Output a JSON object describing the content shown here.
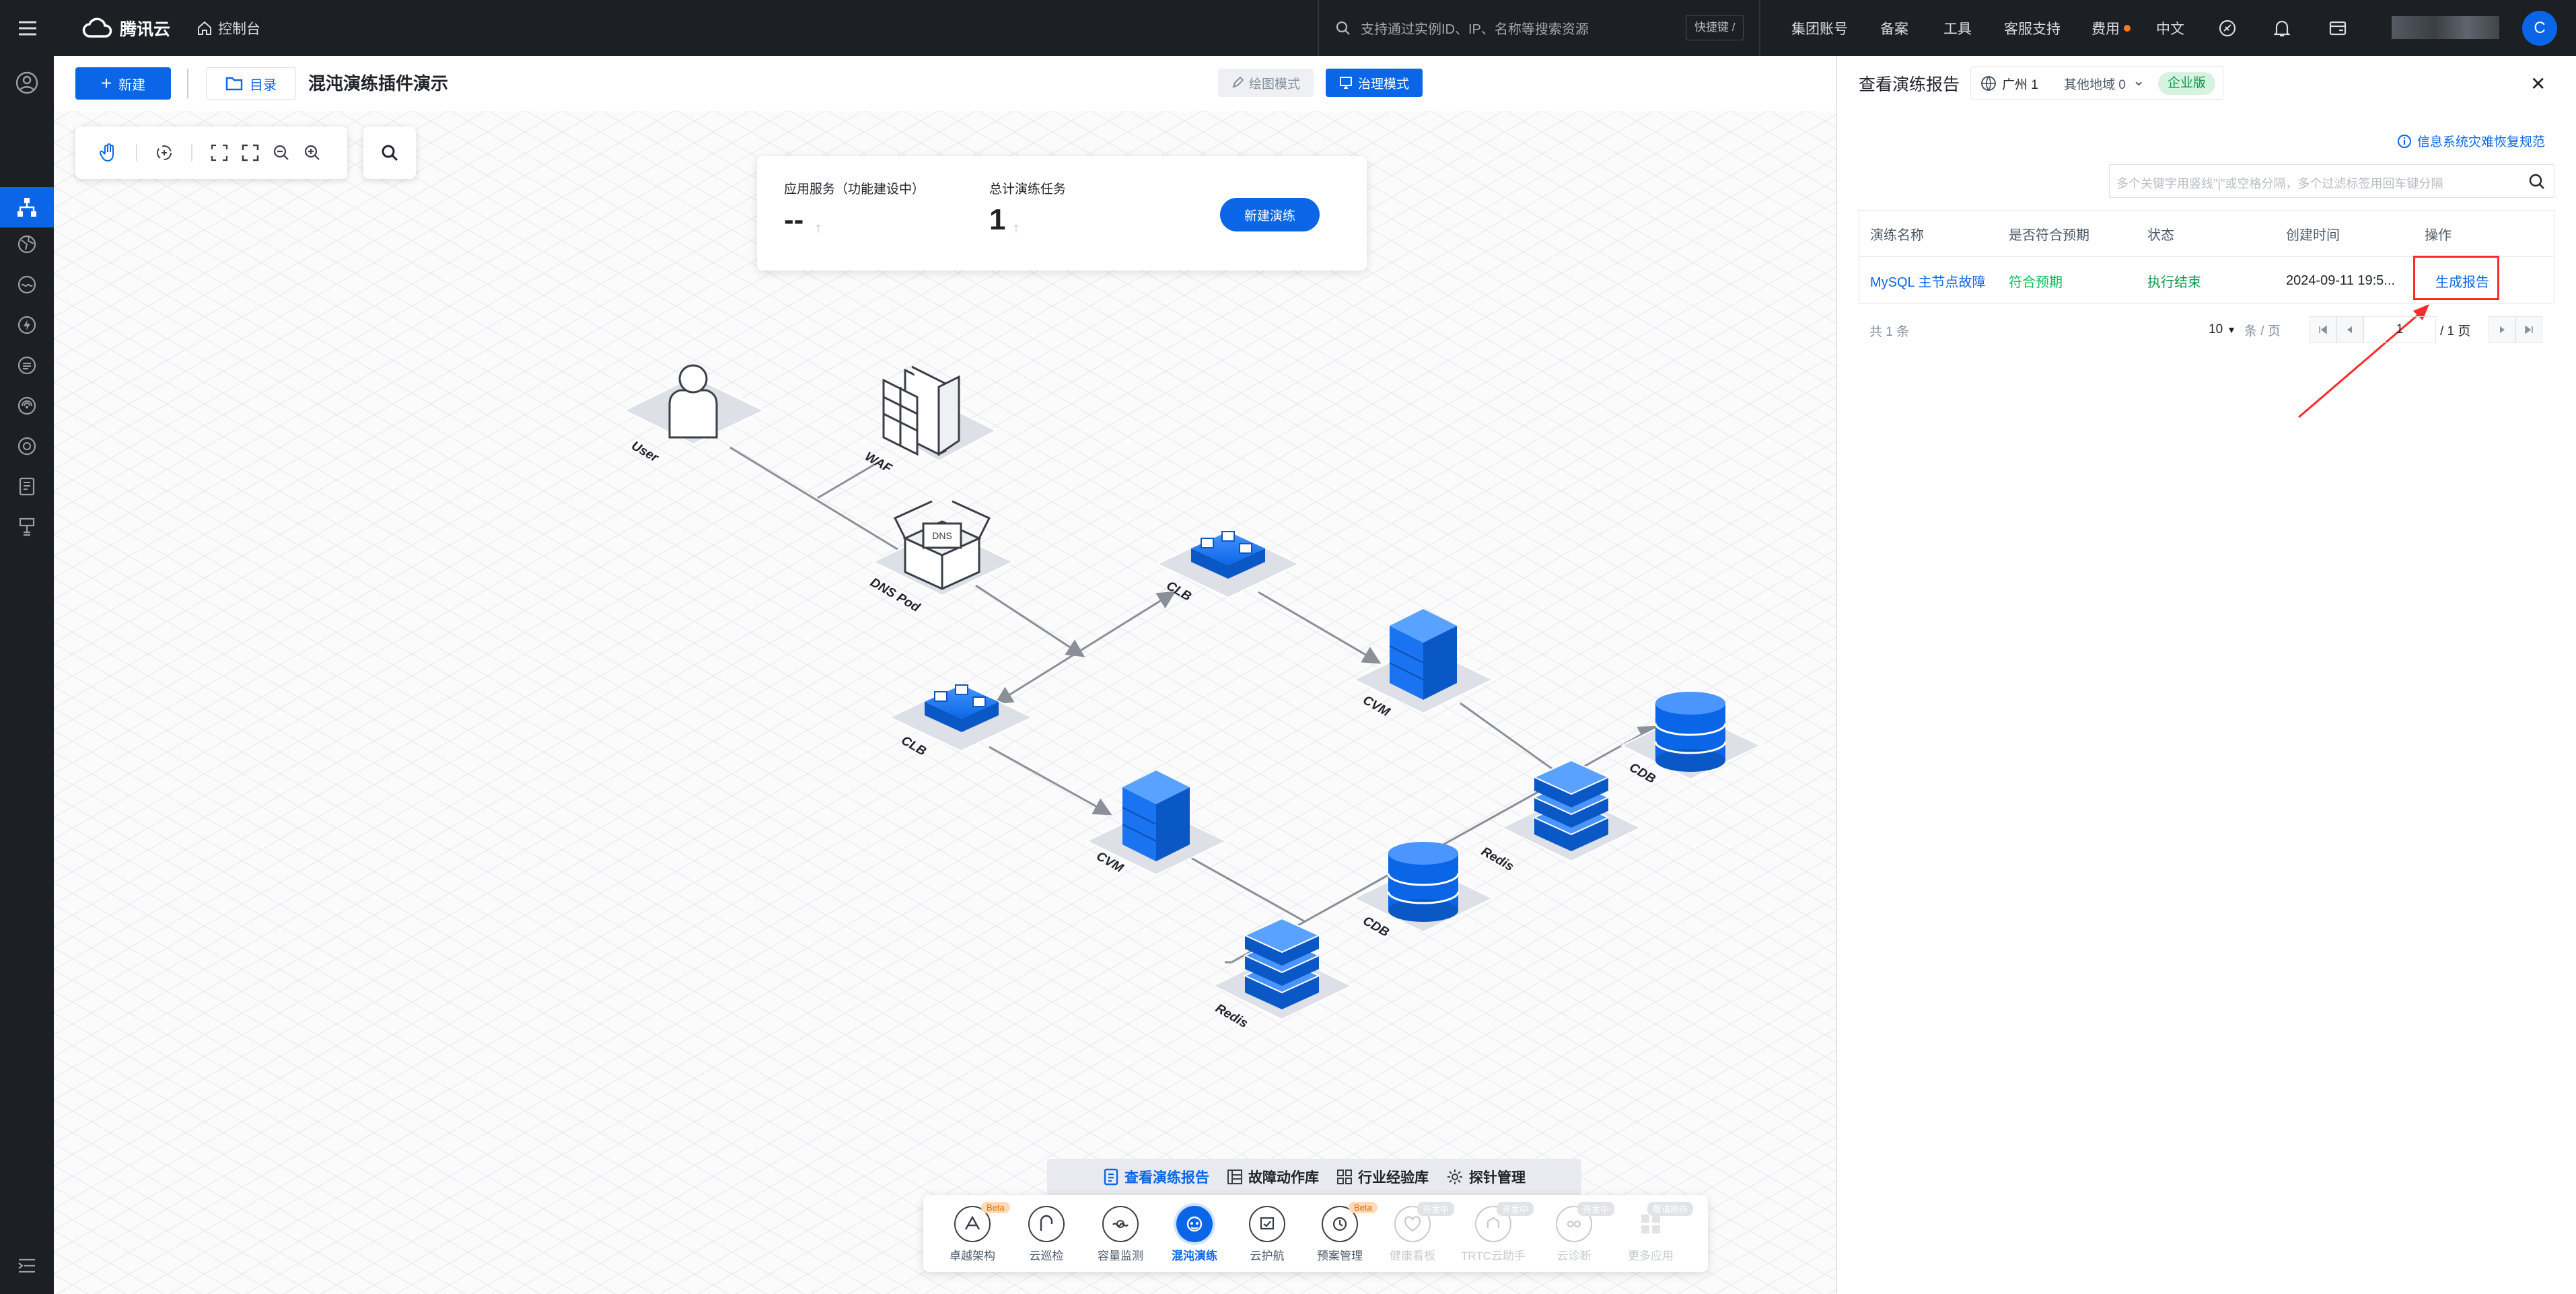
{
  "topbar": {
    "brand": "腾讯云",
    "console": "控制台",
    "search_placeholder": "支持通过实例ID、IP、名称等搜索资源",
    "shortcut": "快捷键 /",
    "nav": [
      "集团账号",
      "备案",
      "工具",
      "客服支持",
      "费用",
      "中文"
    ],
    "avatar": "C"
  },
  "editor": {
    "new_label": "新建",
    "catalog_label": "目录",
    "title": "混沌演练插件演示",
    "draw_mode": "绘图模式",
    "govern_mode": "治理模式"
  },
  "stats": {
    "app_service_label": "应用服务（功能建设中）",
    "app_service_value": "--",
    "total_tasks_label": "总计演练任务",
    "total_tasks_value": "1",
    "new_drill": "新建演练"
  },
  "nodes": {
    "user": "User",
    "waf": "WAF",
    "dns_pod": "DNS Pod",
    "dns_text": "DNS",
    "clb_top": "CLB",
    "clb_left": "CLB",
    "cvm_top": "CVM",
    "cvm_bottom": "CVM",
    "cdb_right": "CDB",
    "cdb_mid": "CDB",
    "redis_right": "Redis",
    "redis_bottom": "Redis"
  },
  "dock_tabs": [
    "查看演练报告",
    "故障动作库",
    "行业经验库",
    "探针管理"
  ],
  "dock_items": [
    {
      "label": "卓越架构",
      "badge": "Beta"
    },
    {
      "label": "云巡检",
      "badge": ""
    },
    {
      "label": "容量监测",
      "badge": ""
    },
    {
      "label": "混沌演练",
      "badge": ""
    },
    {
      "label": "云护航",
      "badge": ""
    },
    {
      "label": "预案管理",
      "badge": "Beta"
    },
    {
      "label": "健康看板",
      "badge": "开发中"
    },
    {
      "label": "TRTC云助手",
      "badge": "开发中"
    },
    {
      "label": "云诊断",
      "badge": "开发中"
    },
    {
      "label": "更多应用",
      "badge": "敬请期待"
    }
  ],
  "panel": {
    "title": "查看演练报告",
    "region": "广州 1",
    "other_region": "其他地域 0",
    "edition": "企业版",
    "help_link": "信息系统灾难恢复规范",
    "search_placeholder": "多个关键字用竖线\"|\"或空格分隔，多个过滤标签用回车键分隔",
    "columns": [
      "演练名称",
      "是否符合预期",
      "状态",
      "创建时间",
      "操作"
    ],
    "rows": [
      {
        "name": "MySQL 主节点故障",
        "expected": "符合预期",
        "status": "执行结束",
        "created": "2024-09-11 19:5...",
        "action": "生成报告"
      }
    ],
    "total": "共 1 条",
    "page_size": "10",
    "per_page": "条 / 页",
    "page_input": "1",
    "page_total": "/ 1 页"
  },
  "colors": {
    "brand": "#0a66e6",
    "success": "#0abf5b",
    "highlight": "#ff2a2a"
  }
}
